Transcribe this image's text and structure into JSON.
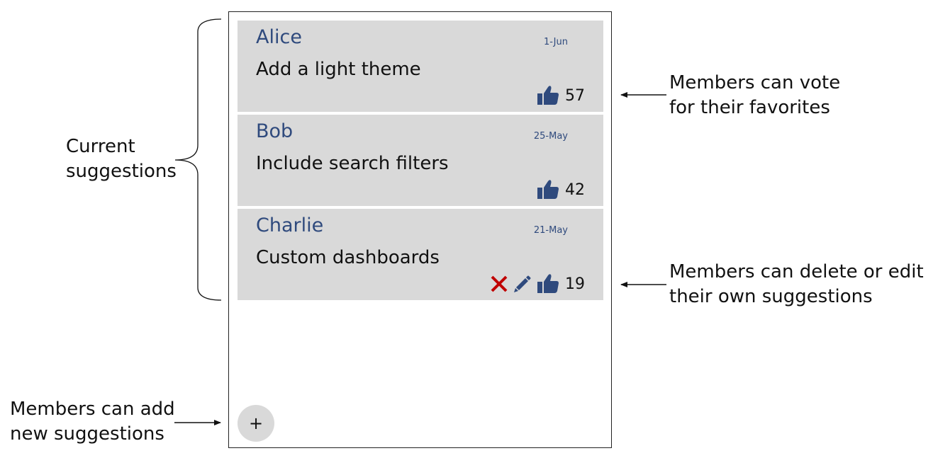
{
  "suggestions": [
    {
      "author": "Alice",
      "date": "1-Jun",
      "text": "Add a light theme",
      "votes": "57",
      "own": false
    },
    {
      "author": "Bob",
      "date": "25-May",
      "text": "Include search filters",
      "votes": "42",
      "own": false
    },
    {
      "author": "Charlie",
      "date": "21-May",
      "text": "Custom dashboards",
      "votes": "19",
      "own": true
    }
  ],
  "add_button": {
    "label": "+"
  },
  "annotations": {
    "current_line1": "Current",
    "current_line2": "suggestions",
    "vote_line1": "Members can vote",
    "vote_line2": "for their favorites",
    "edit_line1": "Members can delete or edit",
    "edit_line2": "their own suggestions",
    "add_line1": "Members can add",
    "add_line2": "new suggestions"
  },
  "icons": {
    "vote": "thumbs-up-icon",
    "delete": "close-icon",
    "edit": "pencil-icon"
  },
  "colors": {
    "author": "#2f4a7d",
    "thumb": "#2f4a7d",
    "delete": "#c00000",
    "card": "#d9d9d9"
  }
}
